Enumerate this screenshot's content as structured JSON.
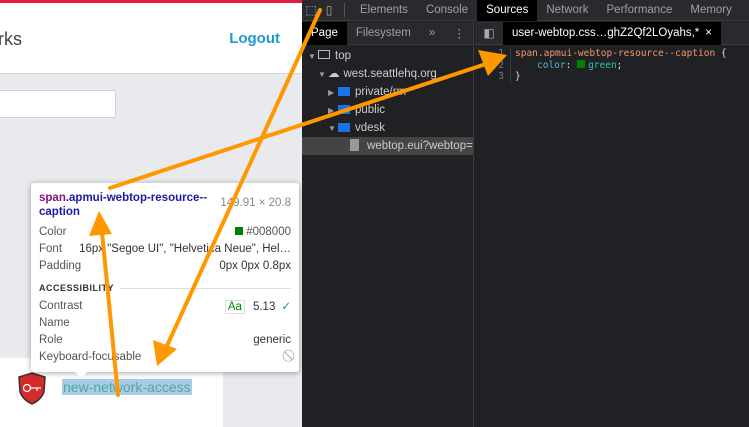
{
  "page": {
    "brand_fragment": "rks",
    "logout": "Logout",
    "search_value": "",
    "resource_caption": "new-network-access"
  },
  "tooltip": {
    "selector_tag": "span",
    "selector_class": ".apmui-webtop-resource--caption",
    "size": "149.91 × 20.8",
    "rows": [
      {
        "label": "Color",
        "value": "#008000"
      },
      {
        "label": "Font",
        "value": "16px \"Segoe UI\", \"Helvetica Neue\", Hel…"
      },
      {
        "label": "Padding",
        "value": "0px 0px 0.8px"
      }
    ],
    "accessibility_heading": "ACCESSIBILITY",
    "contrast_label": "Contrast",
    "contrast_badge": "Aa",
    "contrast_value": "5.13",
    "name_label": "Name",
    "role_label": "Role",
    "role_value": "generic",
    "keyboard_label": "Keyboard-focusable"
  },
  "devtools": {
    "tabs": [
      "Elements",
      "Console",
      "Sources",
      "Network",
      "Performance",
      "Memory"
    ],
    "active_tab": "Sources",
    "side_tabs": [
      "Page",
      "Filesystem"
    ],
    "more": "»",
    "tree": {
      "top": "top",
      "domain": "west.seattlehq.org",
      "folders": [
        "private/rm",
        "public",
        "vdesk"
      ],
      "file": "webtop.eui?webtop=/"
    },
    "file_tab": "user-webtop.css…ghZ2Qf2LOyahs,*",
    "code": {
      "line_numbers": [
        "1",
        "2",
        "3"
      ],
      "selector": "span.apmui-webtop-resource--caption",
      "open": " {",
      "prop": "color",
      "value": "green",
      "close": "}"
    }
  },
  "colors": {
    "accent": "#1a9ad6",
    "highlight": "#008000",
    "arrow": "#ff9800"
  }
}
